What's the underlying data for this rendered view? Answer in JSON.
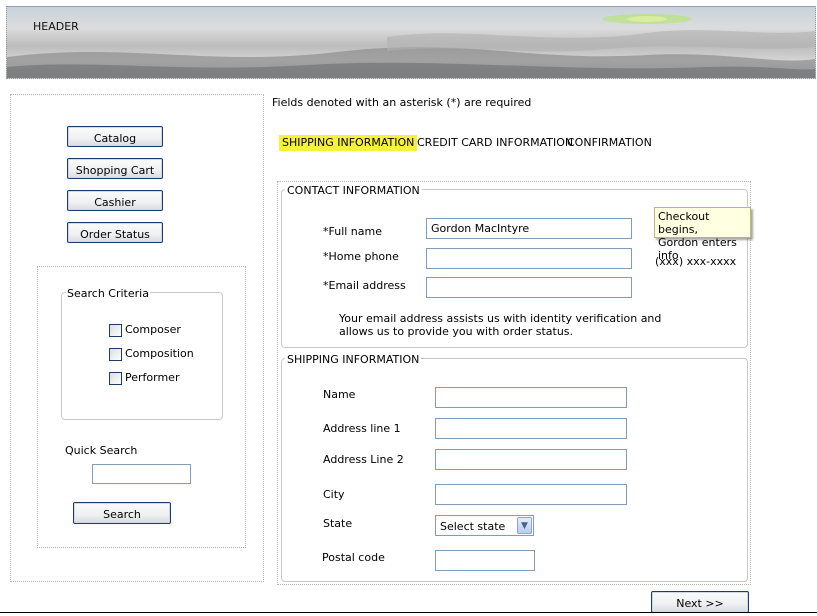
{
  "header": {
    "label": "HEADER"
  },
  "nav": {
    "items": [
      {
        "label": "Catalog"
      },
      {
        "label": "Shopping Cart"
      },
      {
        "label": "Cashier"
      },
      {
        "label": "Order Status"
      }
    ]
  },
  "search": {
    "criteria_title": "Search Criteria",
    "criteria": [
      {
        "label": "Composer",
        "checked": false
      },
      {
        "label": "Composition",
        "checked": false
      },
      {
        "label": "Performer",
        "checked": false
      }
    ],
    "quick_search_label": "Quick Search",
    "quick_search_value": "",
    "search_button": "Search"
  },
  "main": {
    "required_note": "Fields denoted with an asterisk (*) are required",
    "steps": [
      {
        "label": "SHIPPING INFORMATION",
        "active": true
      },
      {
        "label": "CREDIT CARD INFORMATION",
        "active": false
      },
      {
        "label": "CONFIRMATION",
        "active": false
      }
    ],
    "contact": {
      "legend": "CONTACT INFORMATION",
      "full_name_label": "*Full name",
      "full_name_value": "Gordon MacIntyre",
      "home_phone_label": "*Home phone",
      "home_phone_value": "",
      "phone_hint": "(xxx) xxx-xxxx",
      "email_label": "*Email address",
      "email_value": "",
      "email_note": "Your email address assists us with identity verification and allows us to provide you with order status.",
      "tooltip_line1": "Checkout begins,",
      "tooltip_line2": "Gordon enters info"
    },
    "shipping": {
      "legend": "SHIPPING INFORMATION",
      "name_label": "Name",
      "name_value": "",
      "address1_label": "Address line 1",
      "address1_value": "",
      "address2_label": "Address Line 2",
      "address2_value": "",
      "city_label": "City",
      "city_value": "",
      "state_label": "State",
      "state_value": "Select state",
      "postal_label": "Postal code",
      "postal_value": ""
    },
    "next_button": "Next >>"
  },
  "colors": {
    "step_highlight": "#f6f13a",
    "tooltip_bg": "#ffffe1",
    "input_border": "#7f9db9",
    "button_border": "#1c3d6b"
  }
}
